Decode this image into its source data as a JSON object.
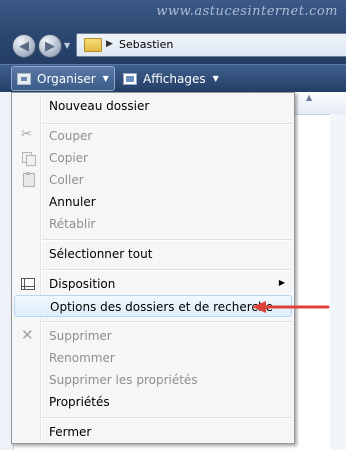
{
  "watermark": "www.astucesinternet.com",
  "address": {
    "current_folder": "Sebastien"
  },
  "toolbar": {
    "organiser_label": "Organiser",
    "affichages_label": "Affichages"
  },
  "menu": {
    "items": [
      {
        "label": "Nouveau dossier",
        "enabled": true
      },
      {
        "label": "Couper",
        "enabled": false,
        "icon": "scissors-icon"
      },
      {
        "label": "Copier",
        "enabled": false,
        "icon": "copy-icon"
      },
      {
        "label": "Coller",
        "enabled": false,
        "icon": "paste-icon"
      },
      {
        "label": "Annuler",
        "enabled": true
      },
      {
        "label": "Rétablir",
        "enabled": false
      },
      {
        "label": "Sélectionner tout",
        "enabled": true
      },
      {
        "label": "Disposition",
        "enabled": true,
        "icon": "layout-icon",
        "submenu": true
      },
      {
        "label": "Options des dossiers et de recherche",
        "enabled": true,
        "highlighted": true
      },
      {
        "label": "Supprimer",
        "enabled": false,
        "icon": "delete-icon"
      },
      {
        "label": "Renommer",
        "enabled": false
      },
      {
        "label": "Supprimer les propriétés",
        "enabled": false
      },
      {
        "label": "Propriétés",
        "enabled": true
      },
      {
        "label": "Fermer",
        "enabled": true
      }
    ]
  },
  "colors": {
    "highlight": "#dfeefb",
    "annotation_arrow": "#e0403a",
    "disabled_text": "#8f8f8f"
  }
}
